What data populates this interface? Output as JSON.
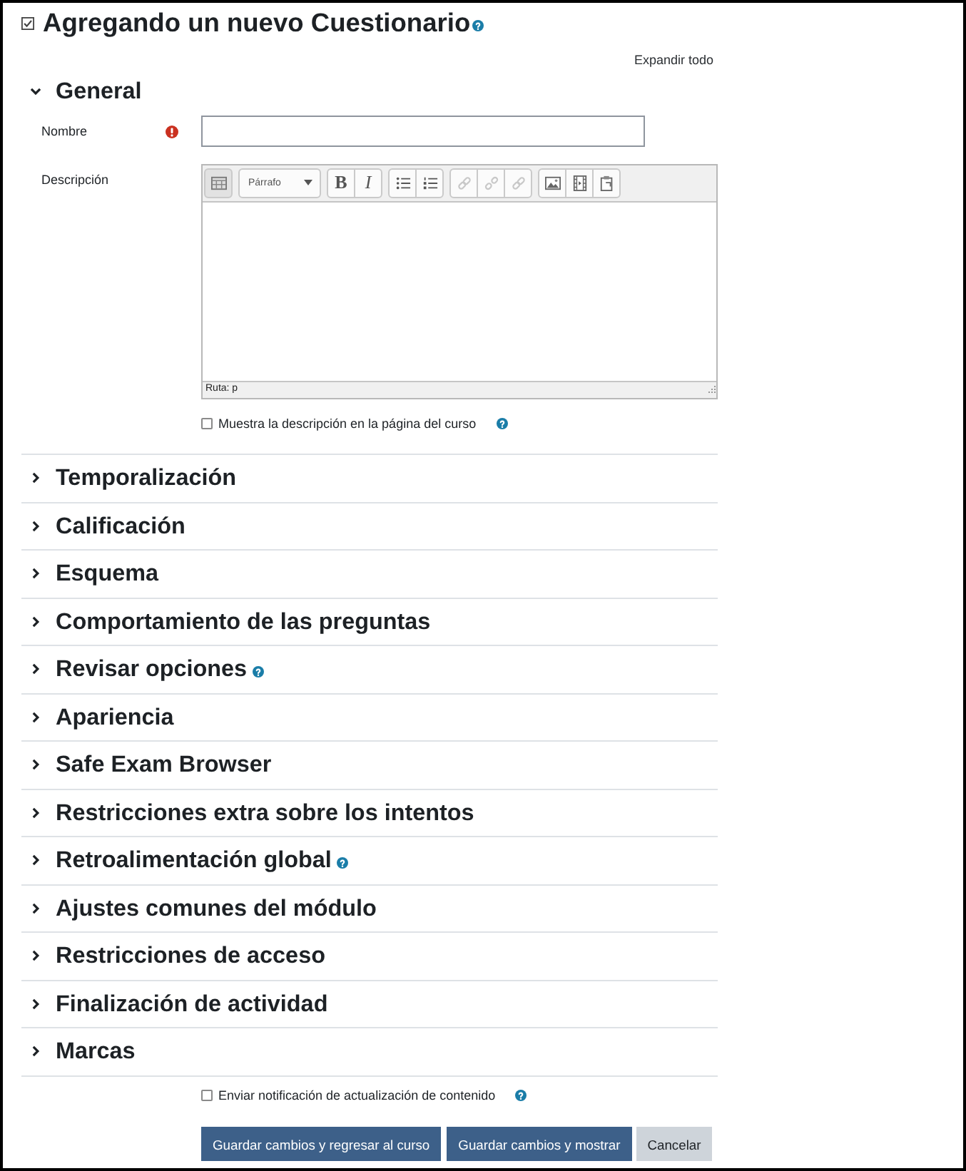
{
  "page": {
    "title": "Agregando un nuevo Cuestionario",
    "title_help": true,
    "expand_all": "Expandir todo"
  },
  "sections": [
    {
      "title": "General",
      "expanded": true,
      "help": false,
      "fields": [
        {
          "kind": "text",
          "label": "Nombre",
          "required": true
        },
        {
          "kind": "editor",
          "label": "Descripción",
          "required": false,
          "path": "Ruta: p",
          "toolbar": [
            {
              "buttons": [
                {
                  "kind": "toggle",
                  "disabled": false
                }
              ]
            },
            {
              "buttons": [
                {
                  "kind": "format",
                  "label": "Párrafo",
                  "disabled": false
                }
              ]
            },
            {
              "buttons": [
                {
                  "kind": "bold",
                  "label": "B",
                  "disabled": false
                },
                {
                  "kind": "italic",
                  "label": "I",
                  "disabled": false
                }
              ]
            },
            {
              "buttons": [
                {
                  "kind": "bullets",
                  "disabled": false
                },
                {
                  "kind": "numbers",
                  "disabled": false
                }
              ]
            },
            {
              "buttons": [
                {
                  "kind": "link",
                  "disabled": true
                },
                {
                  "kind": "unlink",
                  "disabled": true
                },
                {
                  "kind": "link",
                  "disabled": true
                }
              ]
            },
            {
              "buttons": [
                {
                  "kind": "image",
                  "disabled": false
                },
                {
                  "kind": "media",
                  "disabled": false
                },
                {
                  "kind": "paste",
                  "disabled": false
                }
              ]
            }
          ]
        },
        {
          "kind": "checkbox",
          "label": "Muestra la descripción en la página del curso",
          "checked": false,
          "help": true
        }
      ]
    },
    {
      "title": "Temporalización",
      "expanded": false,
      "help": false
    },
    {
      "title": "Calificación",
      "expanded": false,
      "help": false
    },
    {
      "title": "Esquema",
      "expanded": false,
      "help": false
    },
    {
      "title": "Comportamiento de las preguntas",
      "expanded": false,
      "help": false
    },
    {
      "title": "Revisar opciones",
      "expanded": false,
      "help": true
    },
    {
      "title": "Apariencia",
      "expanded": false,
      "help": false
    },
    {
      "title": "Safe Exam Browser",
      "expanded": false,
      "help": false
    },
    {
      "title": "Restricciones extra sobre los intentos",
      "expanded": false,
      "help": false
    },
    {
      "title": "Retroalimentación global",
      "expanded": false,
      "help": true
    },
    {
      "title": "Ajustes comunes del módulo",
      "expanded": false,
      "help": false
    },
    {
      "title": "Restricciones de acceso",
      "expanded": false,
      "help": false
    },
    {
      "title": "Finalización de actividad",
      "expanded": false,
      "help": false
    },
    {
      "title": "Marcas",
      "expanded": false,
      "help": false
    }
  ],
  "notify": {
    "label": "Enviar notificación de actualización de contenido",
    "checked": false,
    "help": true
  },
  "buttons": [
    {
      "label": "Guardar cambios y regresar al curso",
      "kind": "primary"
    },
    {
      "label": "Guardar cambios y mostrar",
      "kind": "primary"
    },
    {
      "label": "Cancelar",
      "kind": "secondary"
    }
  ]
}
